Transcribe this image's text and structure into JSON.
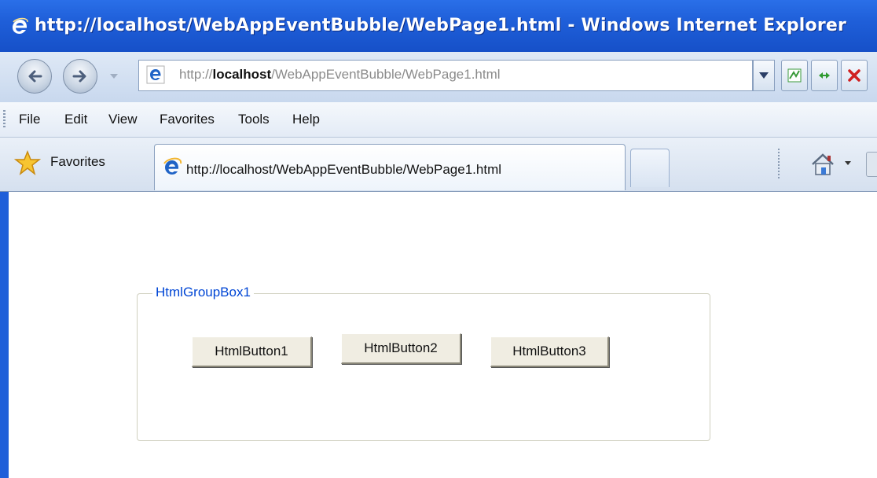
{
  "window": {
    "title": "http://localhost/WebAppEventBubble/WebPage1.html - Windows Internet Explorer"
  },
  "address_bar": {
    "prefix": "http://",
    "host": "localhost",
    "path": "/WebAppEventBubble/WebPage1.html"
  },
  "menu": [
    "File",
    "Edit",
    "View",
    "Favorites",
    "Tools",
    "Help"
  ],
  "favorites_bar": {
    "label": "Favorites"
  },
  "tab": {
    "label": "http://localhost/WebAppEventBubble/WebPage1.html"
  },
  "icons": [
    "ie-logo-icon",
    "back-icon",
    "forward-icon",
    "compatibility-icon",
    "refresh-icon",
    "stop-icon",
    "star-icon",
    "home-icon"
  ],
  "page": {
    "group_box": {
      "legend": "HtmlGroupBox1"
    },
    "buttons": [
      "HtmlButton1",
      "HtmlButton2",
      "HtmlButton3"
    ]
  },
  "colors": {
    "titlebar": "#1f5fd9",
    "legend_text": "#0046d5",
    "button_face": "#f0ede2"
  }
}
